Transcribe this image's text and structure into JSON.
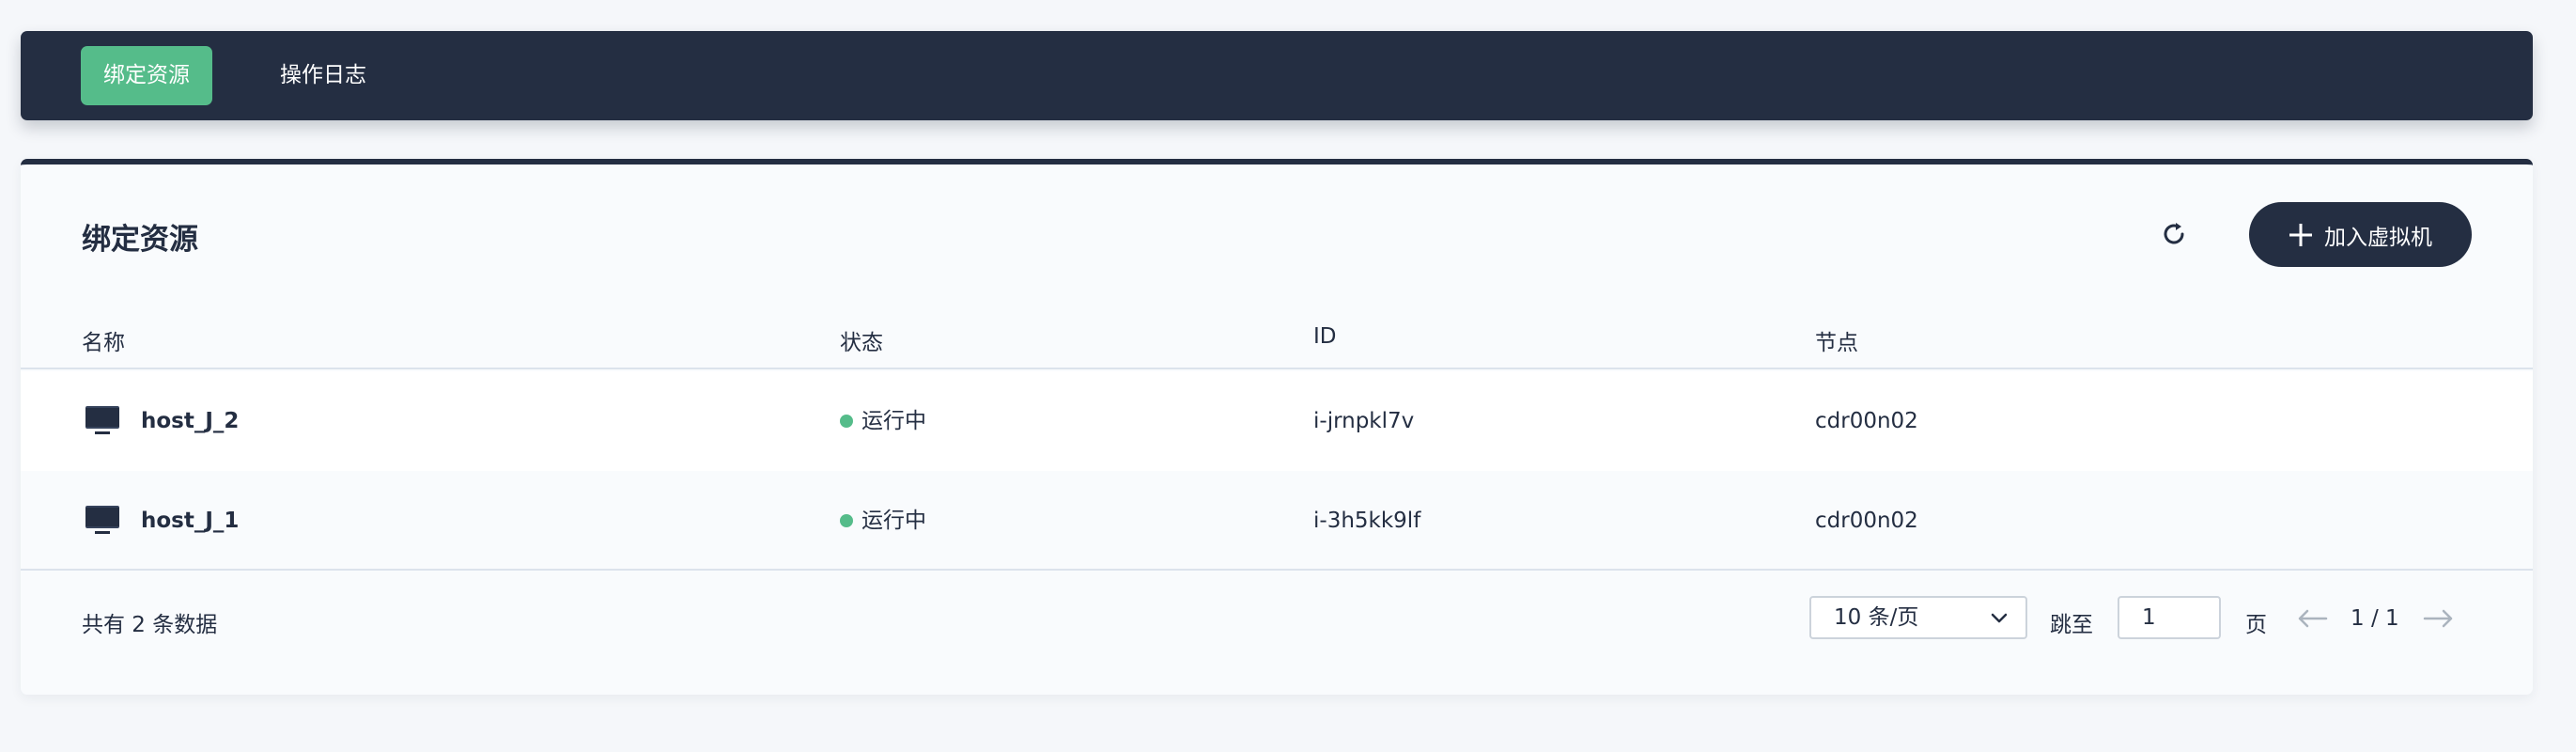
{
  "tabs": [
    {
      "label": "绑定资源",
      "active": true
    },
    {
      "label": "操作日志",
      "active": false
    }
  ],
  "panel": {
    "title": "绑定资源",
    "add_button_label": "加入虚拟机",
    "refresh_icon": "refresh-icon"
  },
  "table": {
    "columns": [
      "名称",
      "状态",
      "ID",
      "节点"
    ],
    "rows": [
      {
        "name": "host_J_2",
        "status": "运行中",
        "id": "i-jrnpkl7v",
        "node": "cdr00n02",
        "icon": "monitor-icon"
      },
      {
        "name": "host_J_1",
        "status": "运行中",
        "id": "i-3h5kk9lf",
        "node": "cdr00n02",
        "icon": "monitor-icon"
      }
    ]
  },
  "footer": {
    "total_text": "共有 2 条数据",
    "page_size": "10 条/页",
    "jump_label": "跳至",
    "jump_value": "1",
    "page_unit": "页",
    "page_indicator": "1 / 1"
  },
  "colors": {
    "primary_dark": "#242e42",
    "accent_green": "#55bc8a",
    "background": "#f5f7fa"
  }
}
